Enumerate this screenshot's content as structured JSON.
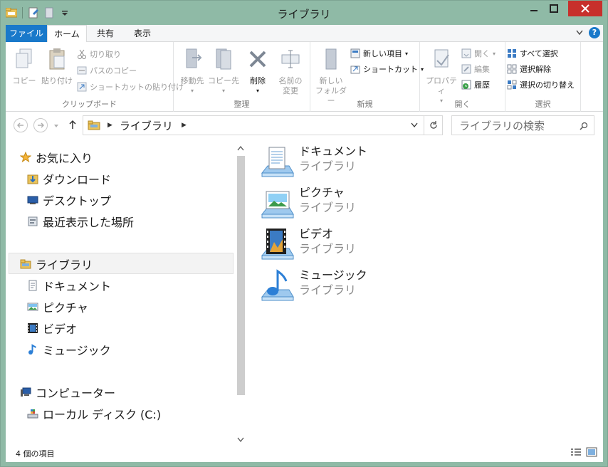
{
  "window": {
    "title": "ライブラリ"
  },
  "tabs": {
    "file": "ファイル",
    "home": "ホーム",
    "share": "共有",
    "view": "表示",
    "help": "?"
  },
  "ribbon": {
    "clipboard": {
      "label": "クリップボード",
      "copy": "コピー",
      "paste": "貼り付け",
      "cut": "切り取り",
      "copy_path": "パスのコピー",
      "paste_shortcut": "ショートカットの貼り付け"
    },
    "organize": {
      "label": "整理",
      "move_to_1": "移動先",
      "copy_to_1": "コピー先",
      "delete": "削除",
      "rename_1": "名前の",
      "rename_2": "変更"
    },
    "new": {
      "label": "新規",
      "new_folder_1": "新しい",
      "new_folder_2": "フォルダー",
      "new_item": "新しい項目",
      "shortcut": "ショートカット"
    },
    "open": {
      "label": "開く",
      "properties": "プロパティ",
      "open": "開く",
      "edit": "編集",
      "history": "履歴"
    },
    "select": {
      "label": "選択",
      "select_all": "すべて選択",
      "select_none": "選択解除",
      "invert": "選択の切り替え"
    }
  },
  "address": {
    "path": "ライブラリ",
    "search_placeholder": "ライブラリの検索"
  },
  "nav": {
    "favorites": "お気に入り",
    "downloads": "ダウンロード",
    "desktop": "デスクトップ",
    "recent": "最近表示した場所",
    "libraries": "ライブラリ",
    "documents": "ドキュメント",
    "pictures": "ピクチャ",
    "videos": "ビデオ",
    "music": "ミュージック",
    "computer": "コンピューター",
    "local_disk": "ローカル ディスク (C:)"
  },
  "items": [
    {
      "name": "ドキュメント",
      "type": "ライブラリ"
    },
    {
      "name": "ピクチャ",
      "type": "ライブラリ"
    },
    {
      "name": "ビデオ",
      "type": "ライブラリ"
    },
    {
      "name": "ミュージック",
      "type": "ライブラリ"
    }
  ],
  "status": {
    "count": "4 個の項目"
  }
}
